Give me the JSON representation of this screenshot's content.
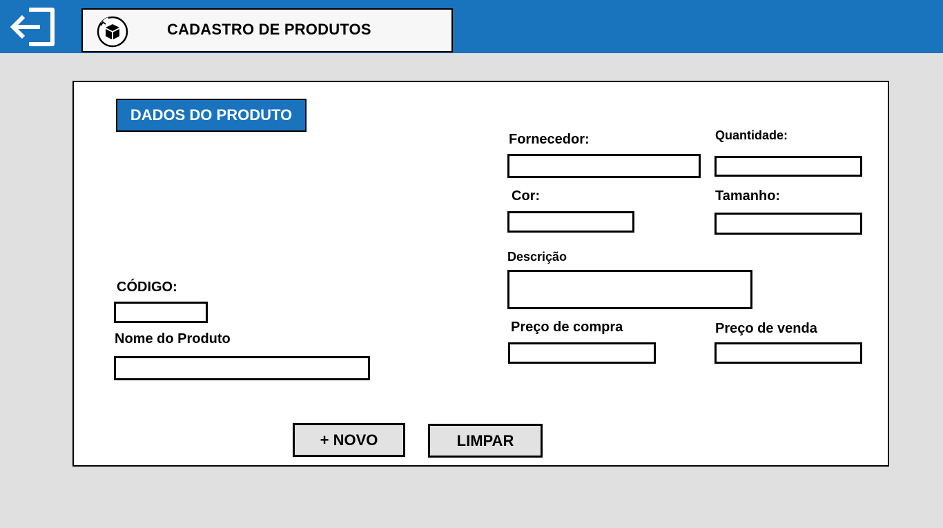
{
  "header": {
    "logout_icon": "logout-arrow-icon",
    "app_icon": "package-box-icon",
    "title": "CADASTRO DE PRODUTOS",
    "background_color": "#1a73bd"
  },
  "form": {
    "section_title": "DADOS DO PRODUTO",
    "fields": {
      "codigo": {
        "label": "CÓDIGO:",
        "value": ""
      },
      "nome_produto": {
        "label": "Nome do Produto",
        "value": ""
      },
      "fornecedor": {
        "label": "Fornecedor:",
        "value": ""
      },
      "quantidade": {
        "label": "Quantidade:",
        "value": ""
      },
      "cor": {
        "label": "Cor:",
        "value": ""
      },
      "tamanho": {
        "label": "Tamanho:",
        "value": ""
      },
      "descricao": {
        "label": "Descrição",
        "value": ""
      },
      "preco_compra": {
        "label": "Preço de compra",
        "value": ""
      },
      "preco_venda": {
        "label": "Preço de venda",
        "value": ""
      }
    },
    "buttons": {
      "novo": "+ NOVO",
      "limpar": "LIMPAR"
    }
  }
}
